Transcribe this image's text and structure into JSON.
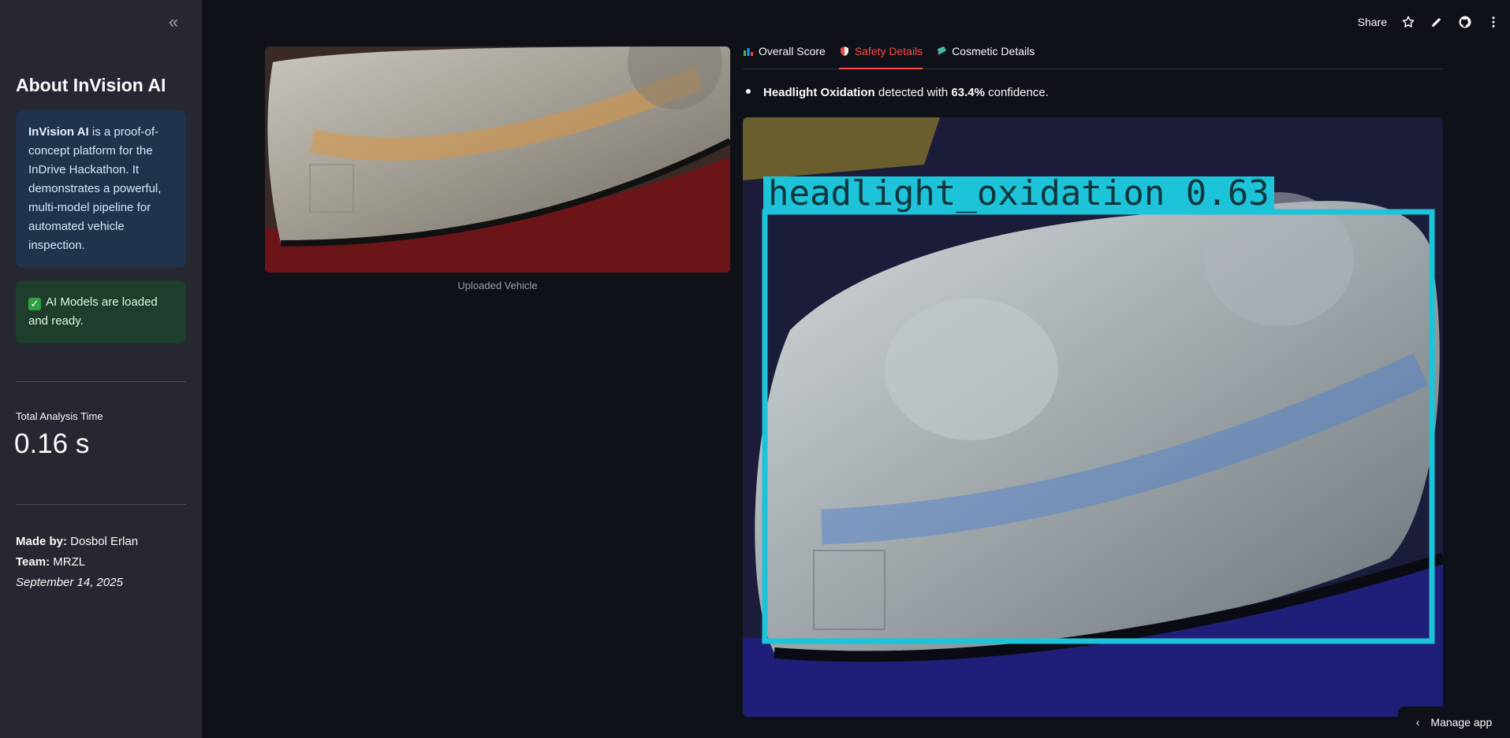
{
  "sidebar": {
    "title": "About InVision AI",
    "info": {
      "name": "InVision AI",
      "text": " is a proof-of-concept platform for the InDrive Hackathon. It demonstrates a powerful, multi-model pipeline for automated vehicle inspection."
    },
    "status": "AI Models are loaded and ready.",
    "metric": {
      "label": "Total Analysis Time",
      "value": "0.16 s"
    },
    "credits": {
      "made_by_label": "Made by:",
      "made_by": " Dosbol Erlan",
      "team_label": "Team:",
      "team": " MRZL",
      "date": "September 14, 2025"
    }
  },
  "toolbar": {
    "share_label": "Share"
  },
  "upload": {
    "caption": "Uploaded Vehicle"
  },
  "tabs": [
    {
      "label": "Overall Score",
      "icon": "bar-chart-icon"
    },
    {
      "label": "Safety Details",
      "icon": "shield-icon"
    },
    {
      "label": "Cosmetic Details",
      "icon": "paint-icon"
    }
  ],
  "result": {
    "label": "Headlight Oxidation",
    "mid": " detected with ",
    "confidence": "63.4%",
    "end": " confidence."
  },
  "detection": {
    "box_label": "headlight_oxidation 0.63",
    "box_color": "#1dc3d8"
  },
  "footer": {
    "manage_label": "Manage app"
  }
}
